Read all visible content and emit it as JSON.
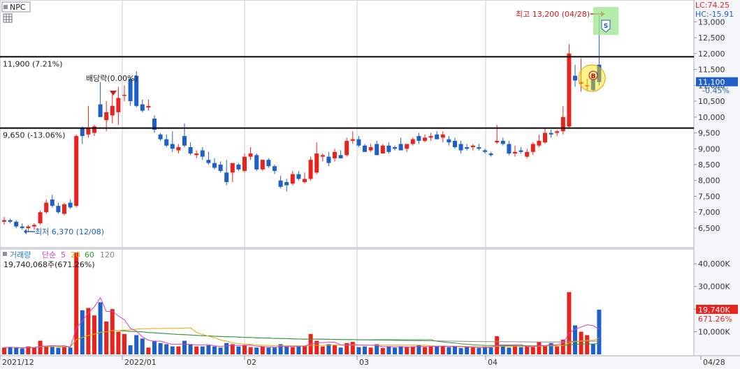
{
  "symbol": "NPC",
  "lc_text": "LC:74.25",
  "hc_text": "HC:-15.91",
  "current_price": "11,100",
  "current_change": "-0.45%",
  "volume_badge": "19,740K",
  "volume_ratio": "671.26%",
  "high_note": "최고 13,200 (04/28)",
  "low_note": "최저 6,370 (12/08)",
  "dividend_note": "배당락(0.00%)",
  "line1_label": "11,900 (7.21%)",
  "line2_label": "9,650 (-13.06%)",
  "marker_buy": "B",
  "marker_sell": "S",
  "volume_legend": {
    "title": "거래량",
    "ma": "단순",
    "p1": "5",
    "p2": "20",
    "p3": "60",
    "p4": "120"
  },
  "volume_info": "19,740,068주(671.26%)",
  "colors": {
    "up": "#e8231e",
    "down": "#1f5fc8",
    "ma5": "#d640c8",
    "ma20": "#e6a800",
    "ma60": "#2a9a3a",
    "ma120": "#8a8a8a"
  },
  "chart_data": {
    "type": "candlestick",
    "x_ticks": [
      "2021/12",
      "2022/01",
      "02",
      "03",
      "04",
      "04/28"
    ],
    "price_ticks": [
      "6,500",
      "7,000",
      "7,500",
      "8,000",
      "8,500",
      "9,000",
      "9,500",
      "10,000",
      "10,500",
      "11,000",
      "11,500",
      "12,000",
      "12,500",
      "13,000"
    ],
    "volume_ticks": [
      "10,000K",
      "20,000K",
      "30,000K",
      "40,000K"
    ],
    "price_ylim": [
      5950,
      13600
    ],
    "volume_ylim": [
      0,
      45000
    ],
    "hlines": [
      11900,
      9650
    ],
    "candles": [
      {
        "o": 6700,
        "h": 6850,
        "l": 6600,
        "c": 6750
      },
      {
        "o": 6750,
        "h": 6800,
        "l": 6650,
        "c": 6700
      },
      {
        "o": 6700,
        "h": 6750,
        "l": 6500,
        "c": 6550
      },
      {
        "o": 6550,
        "h": 6650,
        "l": 6450,
        "c": 6500
      },
      {
        "o": 6500,
        "h": 6600,
        "l": 6370,
        "c": 6550
      },
      {
        "o": 6550,
        "h": 6650,
        "l": 6450,
        "c": 6600
      },
      {
        "o": 6650,
        "h": 7050,
        "l": 6600,
        "c": 7000
      },
      {
        "o": 7000,
        "h": 7400,
        "l": 6950,
        "c": 7300
      },
      {
        "o": 7400,
        "h": 7550,
        "l": 7150,
        "c": 7200
      },
      {
        "o": 7200,
        "h": 7300,
        "l": 6950,
        "c": 7000
      },
      {
        "o": 6950,
        "h": 7300,
        "l": 6900,
        "c": 7250
      },
      {
        "o": 7300,
        "h": 7400,
        "l": 7100,
        "c": 7150
      },
      {
        "o": 7200,
        "h": 9450,
        "l": 7150,
        "c": 9400
      },
      {
        "o": 9650,
        "h": 9700,
        "l": 9150,
        "c": 9400
      },
      {
        "o": 9450,
        "h": 10350,
        "l": 9350,
        "c": 9650
      },
      {
        "o": 9500,
        "h": 9750,
        "l": 9400,
        "c": 9700
      },
      {
        "o": 10400,
        "h": 11100,
        "l": 10000,
        "c": 10000
      },
      {
        "o": 9900,
        "h": 10500,
        "l": 9550,
        "c": 10150
      },
      {
        "o": 10050,
        "h": 10700,
        "l": 9800,
        "c": 10350
      },
      {
        "o": 10150,
        "h": 10950,
        "l": 9750,
        "c": 10600
      },
      {
        "o": 10700,
        "h": 11000,
        "l": 10500,
        "c": 10700
      },
      {
        "o": 11200,
        "h": 11250,
        "l": 10350,
        "c": 10500
      },
      {
        "o": 11300,
        "h": 11450,
        "l": 10300,
        "c": 10350
      },
      {
        "o": 10400,
        "h": 10550,
        "l": 10150,
        "c": 10200
      },
      {
        "o": 10300,
        "h": 10550,
        "l": 10200,
        "c": 10350
      },
      {
        "o": 9950,
        "h": 10050,
        "l": 9500,
        "c": 9600
      },
      {
        "o": 9450,
        "h": 9500,
        "l": 9250,
        "c": 9300
      },
      {
        "o": 9300,
        "h": 9450,
        "l": 9050,
        "c": 9100
      },
      {
        "o": 9150,
        "h": 9550,
        "l": 8900,
        "c": 9000
      },
      {
        "o": 8950,
        "h": 9150,
        "l": 8850,
        "c": 9050
      },
      {
        "o": 9400,
        "h": 9800,
        "l": 9050,
        "c": 9100
      },
      {
        "o": 9050,
        "h": 9200,
        "l": 8800,
        "c": 8850
      },
      {
        "o": 8800,
        "h": 8950,
        "l": 8700,
        "c": 8850
      },
      {
        "o": 8950,
        "h": 9050,
        "l": 8650,
        "c": 8750
      },
      {
        "o": 8650,
        "h": 8900,
        "l": 8500,
        "c": 8550
      },
      {
        "o": 8550,
        "h": 8700,
        "l": 8350,
        "c": 8400
      },
      {
        "o": 8500,
        "h": 8600,
        "l": 8250,
        "c": 8300
      },
      {
        "o": 8250,
        "h": 8650,
        "l": 7850,
        "c": 7950
      },
      {
        "o": 8250,
        "h": 8450,
        "l": 7950,
        "c": 8550
      },
      {
        "o": 8500,
        "h": 8550,
        "l": 8300,
        "c": 8350
      },
      {
        "o": 8300,
        "h": 8850,
        "l": 8250,
        "c": 8750
      },
      {
        "o": 8750,
        "h": 9050,
        "l": 8650,
        "c": 8850
      },
      {
        "o": 8800,
        "h": 8850,
        "l": 8300,
        "c": 8350
      },
      {
        "o": 8350,
        "h": 8650,
        "l": 8300,
        "c": 8650
      },
      {
        "o": 8650,
        "h": 8700,
        "l": 8400,
        "c": 8450
      },
      {
        "o": 8450,
        "h": 8500,
        "l": 8200,
        "c": 8300
      },
      {
        "o": 8000,
        "h": 8150,
        "l": 7750,
        "c": 7800
      },
      {
        "o": 7950,
        "h": 8050,
        "l": 7650,
        "c": 7850
      },
      {
        "o": 7900,
        "h": 8300,
        "l": 7850,
        "c": 8200
      },
      {
        "o": 8200,
        "h": 8300,
        "l": 8000,
        "c": 8050
      },
      {
        "o": 7950,
        "h": 8250,
        "l": 7900,
        "c": 8050
      },
      {
        "o": 8050,
        "h": 8750,
        "l": 8000,
        "c": 8650
      },
      {
        "o": 8250,
        "h": 9200,
        "l": 8200,
        "c": 8850
      },
      {
        "o": 8750,
        "h": 8850,
        "l": 8600,
        "c": 8800
      },
      {
        "o": 8750,
        "h": 8900,
        "l": 8450,
        "c": 8550
      },
      {
        "o": 8700,
        "h": 9000,
        "l": 8600,
        "c": 8900
      },
      {
        "o": 8800,
        "h": 8950,
        "l": 8700,
        "c": 8700
      },
      {
        "o": 8800,
        "h": 9350,
        "l": 8750,
        "c": 9250
      },
      {
        "o": 9250,
        "h": 9550,
        "l": 9150,
        "c": 9300
      },
      {
        "o": 9300,
        "h": 9400,
        "l": 9050,
        "c": 9100
      },
      {
        "o": 9100,
        "h": 9150,
        "l": 8900,
        "c": 8900
      },
      {
        "o": 8950,
        "h": 9150,
        "l": 8900,
        "c": 9050
      },
      {
        "o": 9150,
        "h": 9250,
        "l": 8800,
        "c": 8800
      },
      {
        "o": 8850,
        "h": 9150,
        "l": 8850,
        "c": 9100
      },
      {
        "o": 9100,
        "h": 9200,
        "l": 8850,
        "c": 8900
      },
      {
        "o": 9050,
        "h": 9100,
        "l": 8950,
        "c": 9000
      },
      {
        "o": 9150,
        "h": 9350,
        "l": 9000,
        "c": 8950
      },
      {
        "o": 9000,
        "h": 9150,
        "l": 8900,
        "c": 9150
      },
      {
        "o": 9150,
        "h": 9350,
        "l": 9100,
        "c": 9300
      },
      {
        "o": 9400,
        "h": 9500,
        "l": 9150,
        "c": 9250
      },
      {
        "o": 9250,
        "h": 9450,
        "l": 9200,
        "c": 9350
      },
      {
        "o": 9350,
        "h": 9500,
        "l": 9250,
        "c": 9400
      },
      {
        "o": 9450,
        "h": 9550,
        "l": 9300,
        "c": 9300
      },
      {
        "o": 9350,
        "h": 9550,
        "l": 9200,
        "c": 9450
      },
      {
        "o": 9300,
        "h": 9400,
        "l": 9100,
        "c": 9200
      },
      {
        "o": 9250,
        "h": 9350,
        "l": 9000,
        "c": 9050
      },
      {
        "o": 9150,
        "h": 9250,
        "l": 8850,
        "c": 8950
      },
      {
        "o": 9050,
        "h": 9150,
        "l": 8950,
        "c": 9000
      },
      {
        "o": 9050,
        "h": 9150,
        "l": 8950,
        "c": 9100
      },
      {
        "o": 9050,
        "h": 9150,
        "l": 8950,
        "c": 9000
      },
      {
        "o": 8950,
        "h": 9000,
        "l": 8850,
        "c": 8900
      },
      {
        "o": 8850,
        "h": 8900,
        "l": 8750,
        "c": 8800
      },
      {
        "o": 9200,
        "h": 9750,
        "l": 9150,
        "c": 9250
      },
      {
        "o": 9250,
        "h": 9350,
        "l": 9100,
        "c": 9150
      },
      {
        "o": 9150,
        "h": 9250,
        "l": 8800,
        "c": 8850
      },
      {
        "o": 8850,
        "h": 9100,
        "l": 8750,
        "c": 8900
      },
      {
        "o": 8950,
        "h": 9050,
        "l": 8850,
        "c": 8900
      },
      {
        "o": 8750,
        "h": 9000,
        "l": 8700,
        "c": 8900
      },
      {
        "o": 8900,
        "h": 9200,
        "l": 8800,
        "c": 9150
      },
      {
        "o": 9100,
        "h": 9450,
        "l": 9050,
        "c": 9250
      },
      {
        "o": 9200,
        "h": 9650,
        "l": 9150,
        "c": 9500
      },
      {
        "o": 9500,
        "h": 9600,
        "l": 9350,
        "c": 9450
      },
      {
        "o": 9500,
        "h": 9600,
        "l": 9400,
        "c": 9550
      },
      {
        "o": 9550,
        "h": 10350,
        "l": 9450,
        "c": 10000
      },
      {
        "o": 9700,
        "h": 12300,
        "l": 9650,
        "c": 12000
      },
      {
        "o": 11300,
        "h": 11650,
        "l": 10950,
        "c": 11150
      },
      {
        "o": 11050,
        "h": 11850,
        "l": 10800,
        "c": 11100
      },
      {
        "o": 11000,
        "h": 11200,
        "l": 10850,
        "c": 11000
      },
      {
        "o": 11250,
        "h": 11250,
        "l": 10800,
        "c": 10850
      },
      {
        "o": 11650,
        "h": 13200,
        "l": 11000,
        "c": 11100
      }
    ],
    "volume": [
      3000,
      3200,
      2800,
      2600,
      3500,
      2900,
      6000,
      3500,
      3300,
      2900,
      3400,
      3000,
      45000,
      19500,
      20500,
      17200,
      23000,
      14500,
      20000,
      10000,
      9000,
      4000,
      8500,
      7000,
      3000,
      6000,
      5000,
      4500,
      3500,
      3500,
      6000,
      4500,
      3500,
      3500,
      4000,
      3500,
      3000,
      5000,
      4500,
      3500,
      4000,
      3200,
      3000,
      3500,
      3000,
      3000,
      4500,
      3500,
      3200,
      3500,
      3800,
      9000,
      6000,
      3500,
      4500,
      4000,
      3000,
      5000,
      5500,
      3200,
      3500,
      3000,
      4500,
      2800,
      3500,
      3000,
      3500,
      3200,
      3500,
      4000,
      3200,
      3500,
      3500,
      3800,
      3200,
      3500,
      2800,
      3200,
      3000,
      2800,
      3500,
      3000,
      8000,
      3500,
      3000,
      3800,
      3200,
      3500,
      3200,
      5500,
      4000,
      5000,
      3500,
      6500,
      27500,
      12800,
      10000,
      8500,
      4500,
      19740
    ]
  }
}
